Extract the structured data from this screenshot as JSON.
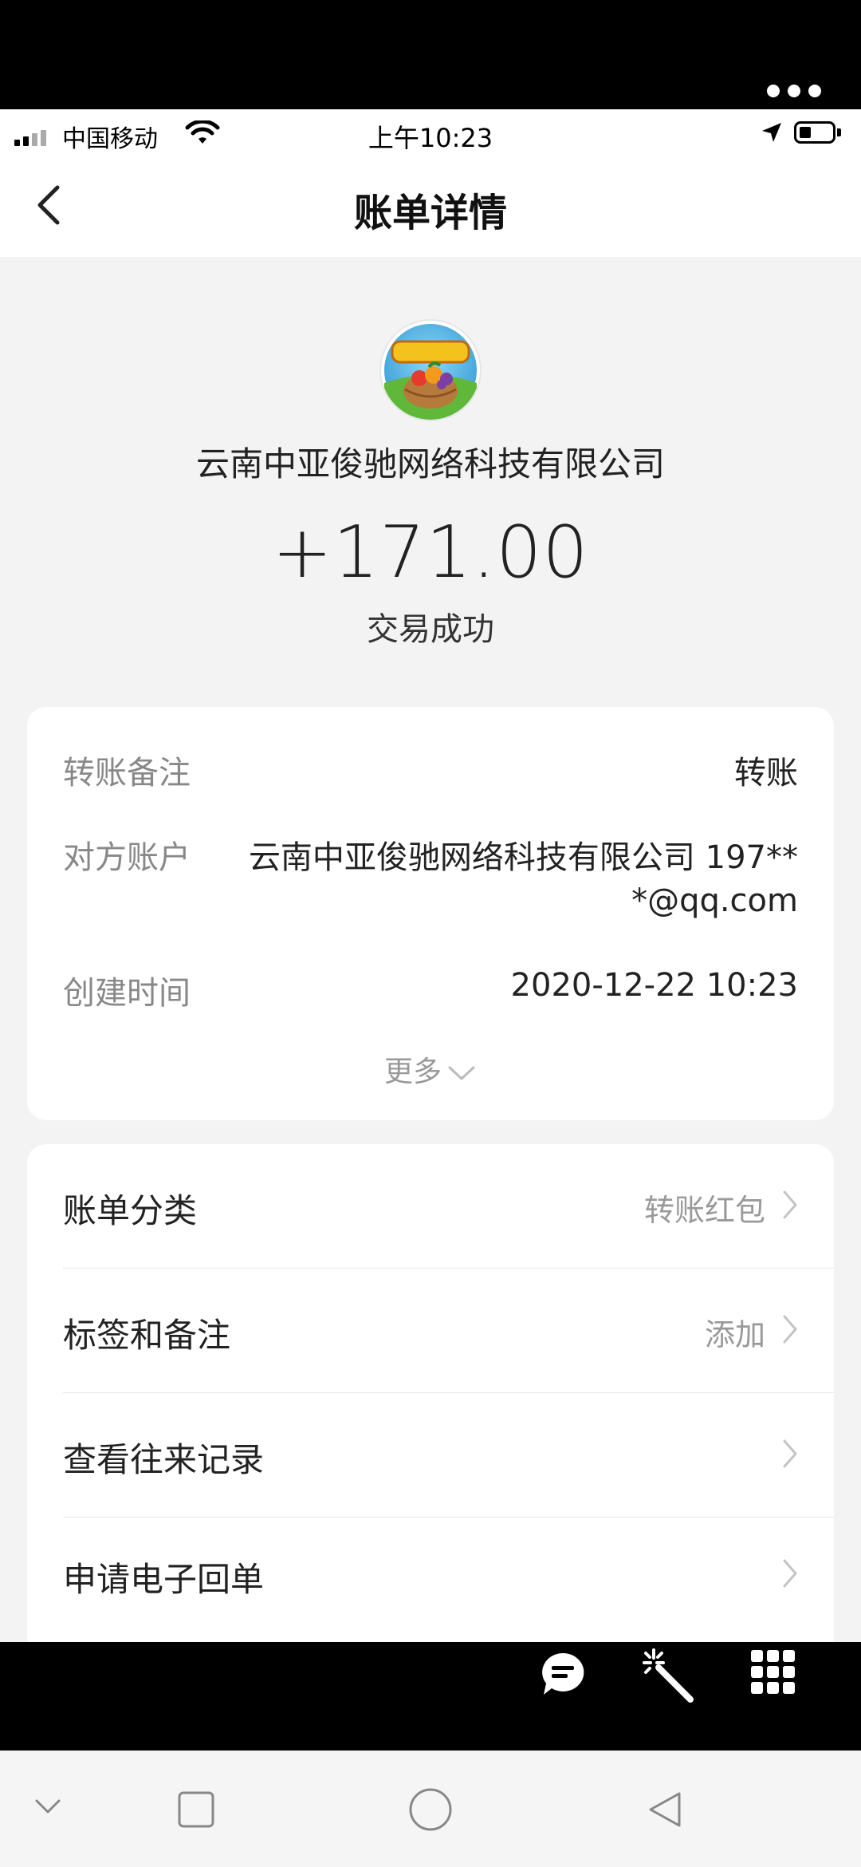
{
  "status_bar": {
    "carrier": "中国移动",
    "time": "上午10:23"
  },
  "nav": {
    "title": "账单详情"
  },
  "merchant": {
    "name": "云南中亚俊驰网络科技有限公司",
    "amount": "+171.00",
    "status": "交易成功"
  },
  "details": {
    "remark_label": "转账备注",
    "remark_value": "转账",
    "account_label": "对方账户",
    "account_value_line1": "云南中亚俊驰网络科技有限公司 197**",
    "account_value_line2": "*@qq.com",
    "created_label": "创建时间",
    "created_value": "2020-12-22 10:23",
    "more_label": "更多"
  },
  "actions": {
    "category_label": "账单分类",
    "category_value": "转账红包",
    "tags_label": "标签和备注",
    "tags_value": "添加",
    "history_label": "查看往来记录",
    "receipt_label": "申请电子回单"
  },
  "icons": {
    "back": "chevron-left-icon",
    "more": "chevron-down-icon",
    "row": "chevron-right-icon",
    "chat": "chat-bubble-icon",
    "magic": "magic-wand-icon",
    "grid": "grid-icon"
  },
  "colors": {
    "page_bg": "#f3f3f3",
    "card_bg": "#ffffff",
    "muted_text": "#888888"
  }
}
